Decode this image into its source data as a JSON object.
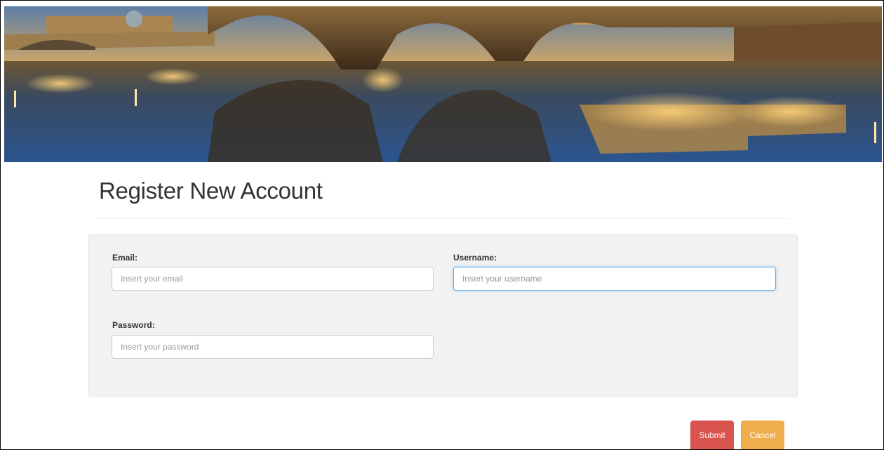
{
  "page": {
    "title": "Register New Account"
  },
  "form": {
    "email": {
      "label": "Email:",
      "placeholder": "Insert your email",
      "value": ""
    },
    "username": {
      "label": "Username:",
      "placeholder": "Insert your username",
      "value": ""
    },
    "password": {
      "label": "Password:",
      "placeholder": "Insert your password",
      "value": ""
    }
  },
  "actions": {
    "submit_label": "Submit",
    "cancel_label": "Cancel"
  },
  "colors": {
    "submit": "#d9534f",
    "cancel": "#f0ad4e",
    "focus": "#66afe9"
  }
}
